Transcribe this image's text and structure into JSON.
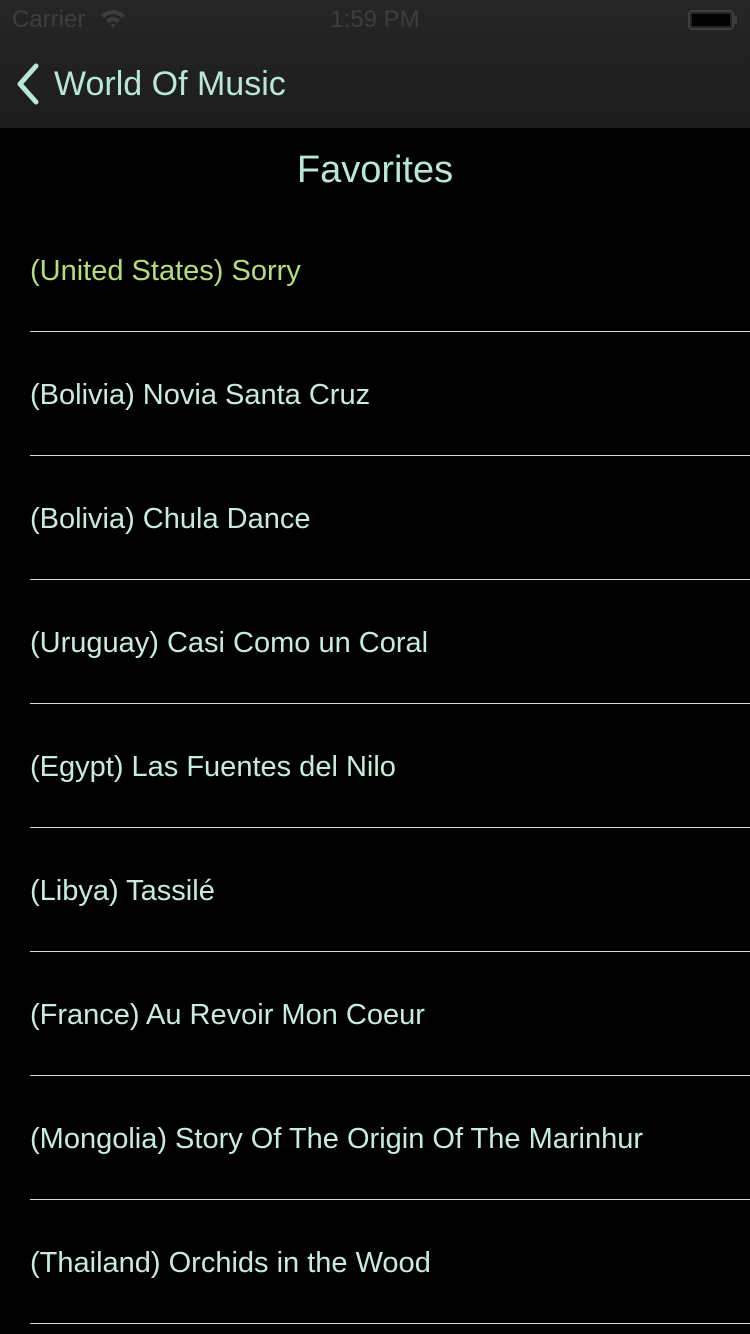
{
  "status_bar": {
    "carrier": "Carrier",
    "time": "1:59 PM"
  },
  "nav": {
    "back_label": "World Of Music",
    "back_icon": "chevron-left-icon"
  },
  "section": {
    "title": "Favorites"
  },
  "colors": {
    "background": "#000000",
    "text": "#c8ecdc",
    "active_text": "#b6dd7c",
    "header": "#222222"
  },
  "favorites": [
    {
      "label": "(United States) Sorry",
      "active": true
    },
    {
      "label": "(Bolivia) Novia Santa Cruz",
      "active": false
    },
    {
      "label": "(Bolivia) Chula Dance",
      "active": false
    },
    {
      "label": "(Uruguay) Casi Como un Coral",
      "active": false
    },
    {
      "label": "(Egypt) Las Fuentes del Nilo",
      "active": false
    },
    {
      "label": "(Libya) Tassilé",
      "active": false
    },
    {
      "label": "(France) Au Revoir Mon Coeur",
      "active": false
    },
    {
      "label": "(Mongolia) Story Of The Origin Of The Marinhur",
      "active": false
    },
    {
      "label": "(Thailand) Orchids in the Wood",
      "active": false
    }
  ]
}
